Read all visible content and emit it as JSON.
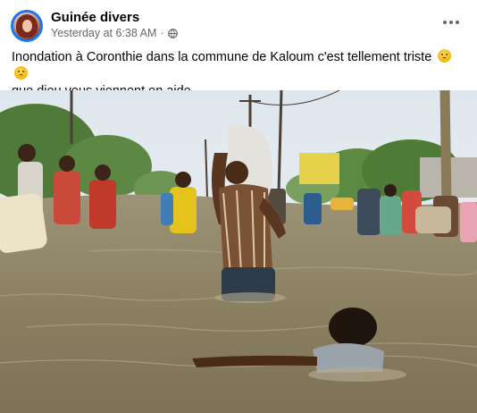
{
  "post": {
    "page_name": "Guinée divers",
    "timestamp": "Yesterday at 6:38 AM",
    "separator": "·",
    "privacy_icon": "globe-icon",
    "more_icon": "more-options-icon",
    "text_line1": "Inondation à Coronthie dans la commune de Kaloum c'est  tellement triste",
    "text_line2": "que dieu vous viennent en aide",
    "emojis": [
      "sad-face-emoji",
      "sad-face-emoji"
    ]
  },
  "colors": {
    "name_text": "#050505",
    "meta_text": "#65676b",
    "avatar_ring": "#1877f2",
    "floodwater": "#8f8466",
    "sky": "#e8eef3"
  }
}
